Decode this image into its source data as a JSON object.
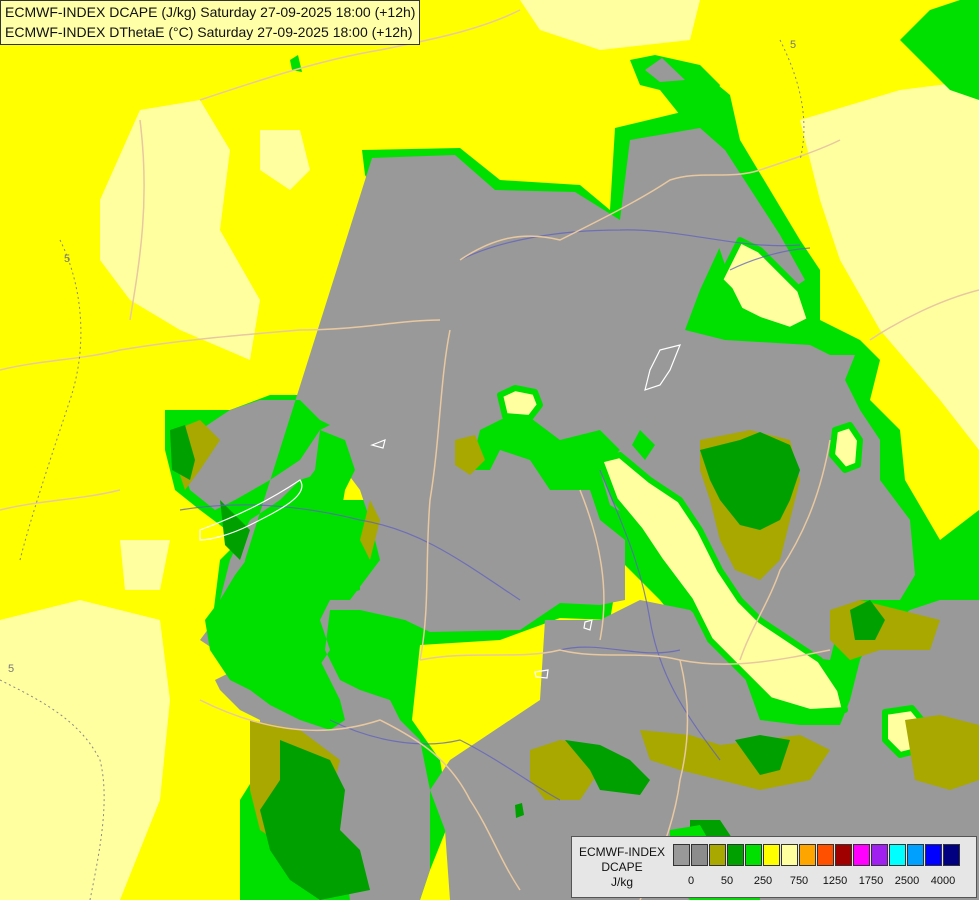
{
  "title": {
    "line1": "ECMWF-INDEX DCAPE (J/kg) Saturday 27-09-2025 18:00 (+12h)",
    "line2": "ECMWF-INDEX DThetaE (°C) Saturday 27-09-2025 18:00 (+12h)"
  },
  "contour_labels": [
    "5",
    "5",
    "5"
  ],
  "legend": {
    "line1": "ECMWF-INDEX",
    "line2": "DCAPE",
    "unit": "J/kg",
    "colors": [
      "#999999",
      "#8c8c8c",
      "#a8a800",
      "#00a000",
      "#00e000",
      "#ffff00",
      "#ffffa0",
      "#ffa500",
      "#ff5000",
      "#a00000",
      "#ff00ff",
      "#a020f0",
      "#00ffff",
      "#00a0ff",
      "#0000ff",
      "#000080"
    ],
    "ticks": [
      "0",
      "50",
      "250",
      "750",
      "1250",
      "1750",
      "2500",
      "4000"
    ]
  },
  "colors": {
    "bg_yellow": "#ffff00",
    "pale_yellow": "#ffffa0",
    "grey": "#999999",
    "olive": "#a8a800",
    "dark_green": "#00a000",
    "bright_green": "#00e000",
    "border": "#e8c8a0",
    "river": "#6060c0"
  }
}
